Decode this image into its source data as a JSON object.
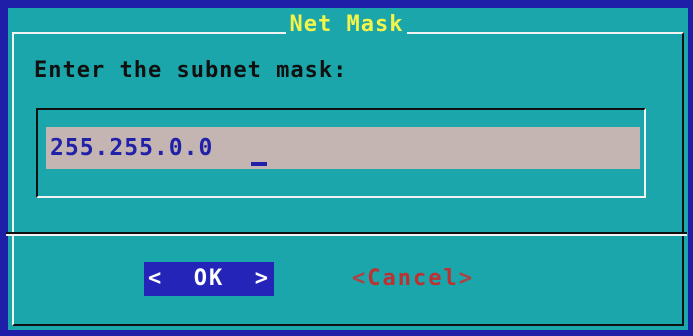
{
  "dialog": {
    "title": "Net Mask",
    "prompt": "Enter the subnet mask:",
    "input": {
      "value": "255.255.0.0"
    },
    "buttons": {
      "ok": {
        "left_bracket": "<",
        "label": "OK",
        "right_bracket": ">"
      },
      "cancel": {
        "left_bracket": "<",
        "label": "Cancel",
        "right_bracket": ">"
      }
    }
  },
  "colors": {
    "screen_background": "#1e1ea8",
    "dialog_background": "#1aa6aa",
    "title_text": "#f4f44a",
    "input_background": "#c4b4b2",
    "input_text": "#2020a8",
    "selected_button_background": "#2424b8",
    "cancel_text": "#b04040"
  }
}
